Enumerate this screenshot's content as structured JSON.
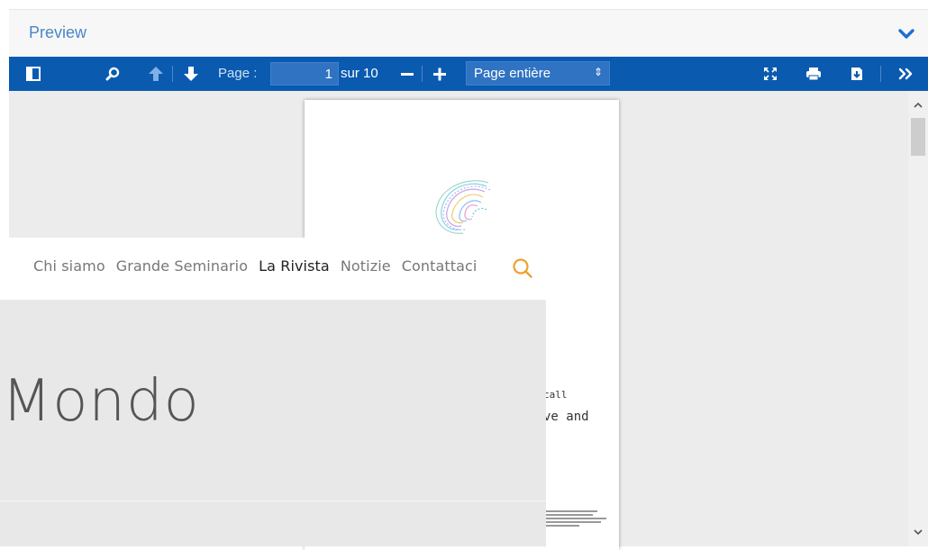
{
  "preview": {
    "title": "Preview"
  },
  "toolbar": {
    "page_label": "Page :",
    "page_value": "1",
    "of_label": "sur 10",
    "zoom_value": "Page entière"
  },
  "page": {
    "text_line1": "call",
    "text_line2": "ve and"
  },
  "overlay": {
    "nav": [
      {
        "label": "Chi siamo"
      },
      {
        "label": "Grande Seminario"
      },
      {
        "label": "La Rivista"
      },
      {
        "label": "Notizie"
      },
      {
        "label": "Contattaci"
      }
    ],
    "hero_title": "Mondo"
  },
  "colors": {
    "toolbar": "#0a5ab0",
    "preview_title": "#4a86c8",
    "search_accent": "#f0a030"
  }
}
